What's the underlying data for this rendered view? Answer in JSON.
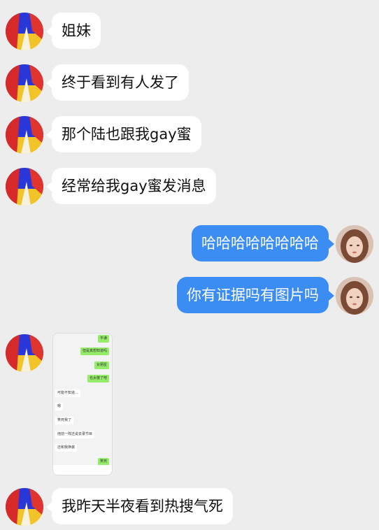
{
  "colors": {
    "background": "#ededed",
    "received_bubble": "#ffffff",
    "sent_bubble": "#3b8df4",
    "sent_text": "#ffffff",
    "screenshot_green_bubble": "#95ec69"
  },
  "messages": [
    {
      "side": "left",
      "text": "姐妹"
    },
    {
      "side": "left",
      "text": "终于看到有人发了"
    },
    {
      "side": "left",
      "text": "那个陆也跟我gay蜜"
    },
    {
      "side": "left",
      "text": "经常给我gay蜜发消息"
    },
    {
      "side": "right",
      "text": "哈哈哈哈哈哈哈哈"
    },
    {
      "side": "right",
      "text": "你有证据吗有图片吗"
    },
    {
      "side": "left",
      "type": "image",
      "image_lines": [
        {
          "side": "right",
          "text": "平谦"
        },
        {
          "side": "right",
          "text": "但是真想知道吗"
        },
        {
          "side": "right",
          "text": "女朋星"
        },
        {
          "side": "right",
          "text": "也太傻了吧"
        },
        {
          "side": "left",
          "text": "可能不知道..."
        },
        {
          "side": "left",
          "text": "嗯"
        },
        {
          "side": "left",
          "text": "笑死我了"
        },
        {
          "side": "left",
          "text": "他前一阵还说去录节目"
        },
        {
          "side": "left",
          "text": "还和我换装"
        },
        {
          "side": "right",
          "text": "笑死"
        }
      ]
    },
    {
      "side": "left",
      "text": "我昨天半夜看到热搜气死"
    }
  ],
  "avatars": {
    "received": "abstract-red-blue-flame-avatar",
    "sent": "woman-portrait-avatar"
  }
}
